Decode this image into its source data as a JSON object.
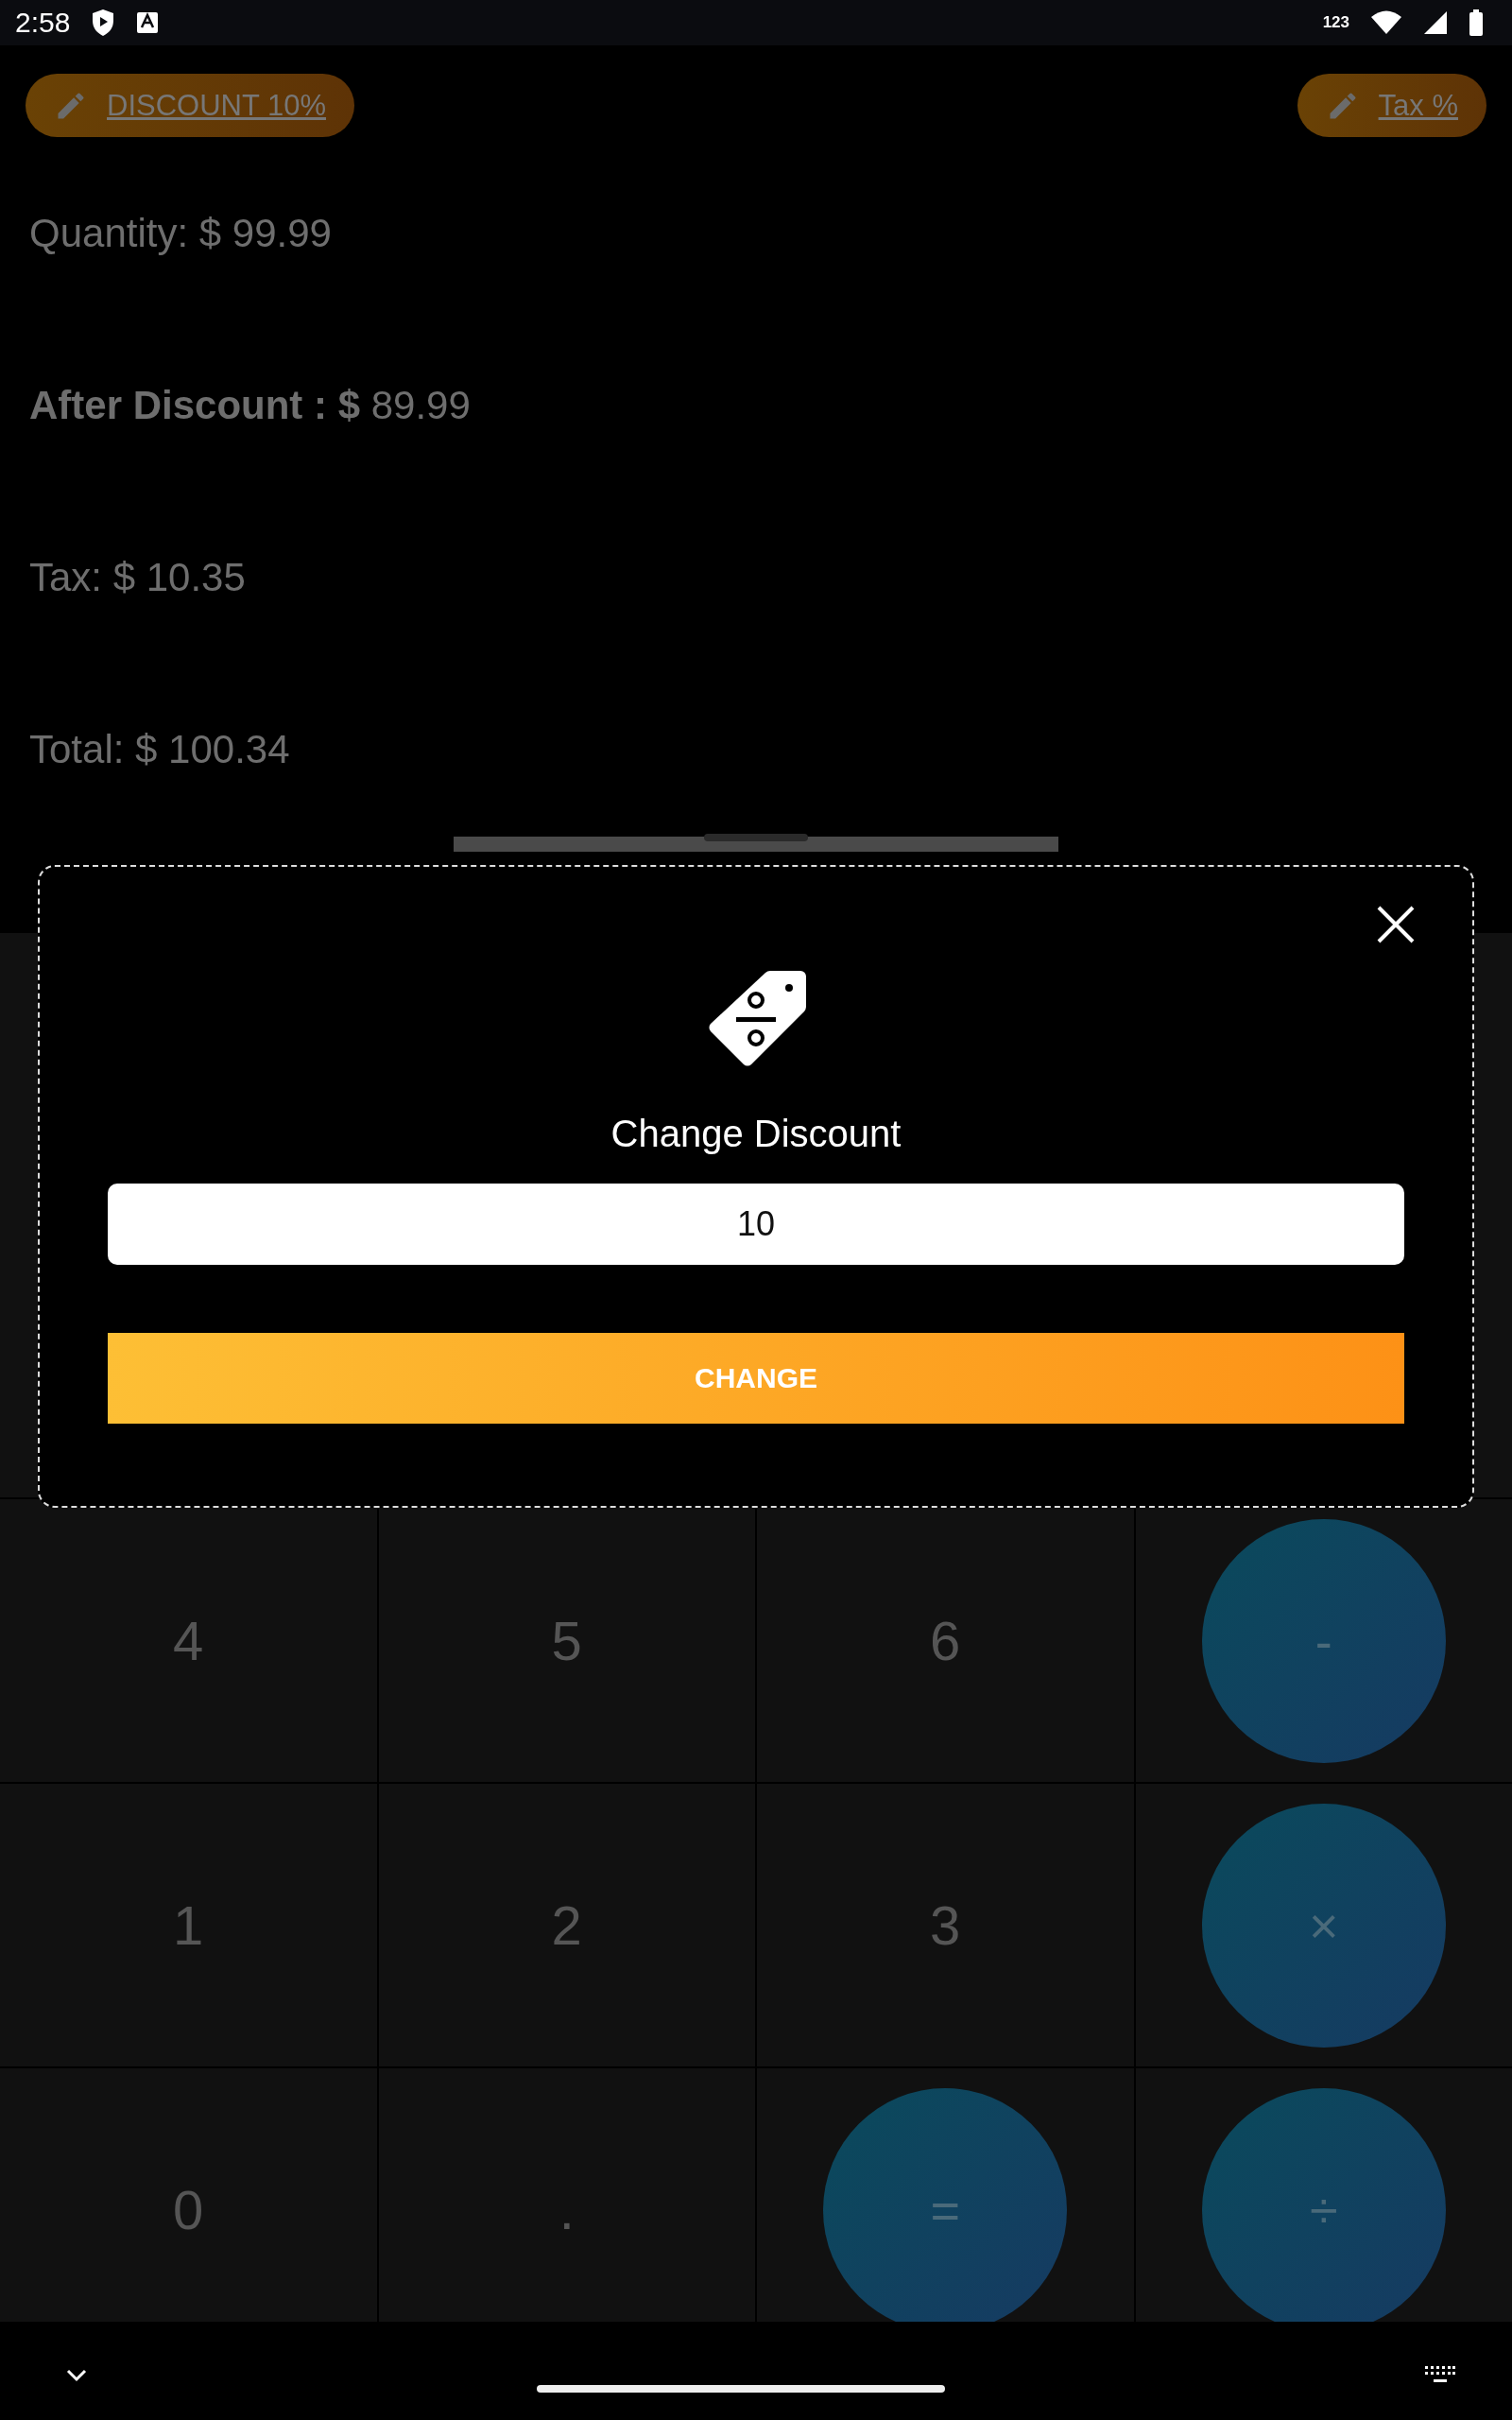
{
  "status_bar": {
    "time": "2:58",
    "network_label": "123"
  },
  "top_buttons": [
    {
      "label": "DISCOUNT 10%"
    },
    {
      "label": "Tax %"
    }
  ],
  "summary": [
    "Quantity: $ 99.99",
    "**After Discount : $** 89.99",
    "Tax: $ 10.35",
    "Total: $ 100.34"
  ],
  "keypad": [
    {
      "label": "4",
      "kind": "digit"
    },
    {
      "label": "5",
      "kind": "digit"
    },
    {
      "label": "6",
      "kind": "digit"
    },
    {
      "label": "-",
      "kind": "operator"
    },
    {
      "label": "1",
      "kind": "digit"
    },
    {
      "label": "2",
      "kind": "digit"
    },
    {
      "label": "3",
      "kind": "digit"
    },
    {
      "label": "×",
      "kind": "operator"
    },
    {
      "label": "0",
      "kind": "digit"
    },
    {
      "label": ".",
      "kind": "digit"
    },
    {
      "label": "=",
      "kind": "operator"
    },
    {
      "label": "÷",
      "kind": "operator"
    }
  ],
  "dialog": {
    "title": "Change Discount",
    "input_value": "10",
    "button": "CHANGE"
  }
}
